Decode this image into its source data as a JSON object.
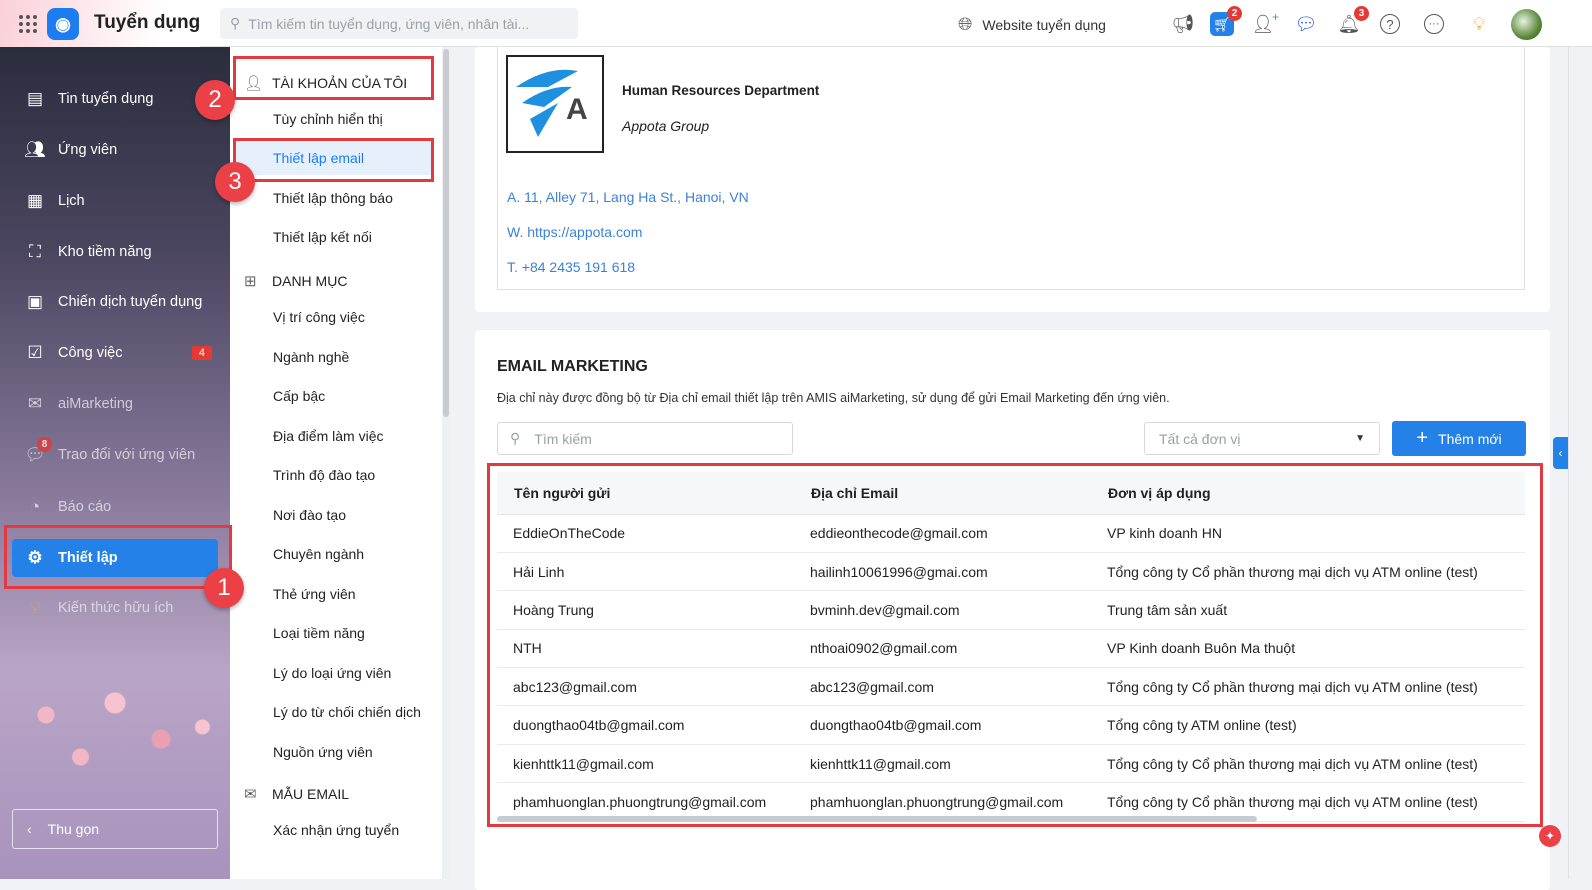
{
  "topbar": {
    "app_name": "Tuyển dụng",
    "search_placeholder": "Tìm kiếm tin tuyển dụng, ứng viên, nhân tài...",
    "website_link": "Website tuyển dụng",
    "cart_badge": "2",
    "notification_badge": "3"
  },
  "sidebar": {
    "items": [
      {
        "label": "Tin tuyển dụng",
        "icon": "job-post-icon"
      },
      {
        "label": "Ứng viên",
        "icon": "users-icon"
      },
      {
        "label": "Lịch",
        "icon": "calendar-icon"
      },
      {
        "label": "Kho tiềm năng",
        "icon": "talent-pool-icon"
      },
      {
        "label": "Chiến dịch tuyển dụng",
        "icon": "campaign-icon"
      },
      {
        "label": "Công việc",
        "icon": "task-icon",
        "badge": "4"
      },
      {
        "label": "aiMarketing",
        "icon": "mail-icon"
      },
      {
        "label": "Trao đổi với ứng viên",
        "icon": "chat-icon",
        "badge": "8"
      },
      {
        "label": "Báo cáo",
        "icon": "report-icon"
      },
      {
        "label": "Thiết lập",
        "icon": "gear-icon"
      },
      {
        "label": "Kiến thức hữu ích",
        "icon": "knowledge-icon"
      }
    ],
    "collapse_label": "Thu gọn"
  },
  "settings_menu": {
    "section_account": "TÀI KHOẢN CỦA TÔI",
    "account_items": [
      "Tùy chỉnh hiển thị",
      "Thiết lập email",
      "Thiết lập thông báo",
      "Thiết lập kết nối"
    ],
    "section_catalog": "DANH MỤC",
    "catalog_items": [
      "Vị trí công việc",
      "Ngành nghề",
      "Cấp bậc",
      "Địa điểm làm việc",
      "Trình độ đào tạo",
      "Nơi đào tạo",
      "Chuyên ngành",
      "Thẻ ứng viên",
      "Loại tiềm năng",
      "Lý do loại ứng viên",
      "Lý do từ chối chiến dịch",
      "Nguồn ứng viên"
    ],
    "section_templates": "MẪU EMAIL",
    "template_items": [
      "Xác nhận ứng tuyển"
    ]
  },
  "signature": {
    "department": "Human Resources Department",
    "company": "Appota Group",
    "address": "A. 11, Alley 71, Lang Ha St., Hanoi, VN",
    "website": "W. https://appota.com",
    "phone": "T. +84 2435 191 618"
  },
  "email_marketing": {
    "title": "EMAIL MARKETING",
    "description": "Địa chỉ này được đồng bộ từ Địa chỉ email thiết lập trên AMIS aiMarketing, sử dụng để gửi Email Marketing đến ứng viên.",
    "search_placeholder": "Tìm kiếm",
    "unit_filter": "Tất cả đơn vị",
    "add_button": "Thêm mới",
    "columns": [
      "Tên người gửi",
      "Địa chỉ Email",
      "Đơn vị áp dụng"
    ],
    "rows": [
      [
        "EddieOnTheCode",
        "eddieonthecode@gmail.com",
        "VP kinh doanh HN"
      ],
      [
        "Hải Linh",
        "hailinh10061996@gmai.com",
        "Tổng công ty Cổ phần thương mại dịch vụ ATM online (test)"
      ],
      [
        "Hoàng Trung",
        "bvminh.dev@gmail.com",
        "Trung tâm sản xuất"
      ],
      [
        "NTH",
        "nthoai0902@gmail.com",
        "VP Kinh doanh Buôn Ma thuột"
      ],
      [
        "abc123@gmail.com",
        "abc123@gmail.com",
        "Tổng công ty Cổ phần thương mại dịch vụ ATM online (test)"
      ],
      [
        "duongthao04tb@gmail.com",
        "duongthao04tb@gmail.com",
        "Tổng công ty ATM online (test)"
      ],
      [
        "kienhttk11@gmail.com",
        "kienhttk11@gmail.com",
        "Tổng công ty Cổ phần thương mại dịch vụ ATM online (test)"
      ],
      [
        "phamhuonglan.phuongtrung@gmail.com",
        "phamhuonglan.phuongtrung@gmail.com",
        "Tổng công ty Cổ phần thương mại dịch vụ ATM online (test)"
      ]
    ]
  },
  "annotations": [
    "1",
    "2",
    "3"
  ],
  "colors": {
    "accent": "#2481e8",
    "annotation": "#e53940"
  }
}
